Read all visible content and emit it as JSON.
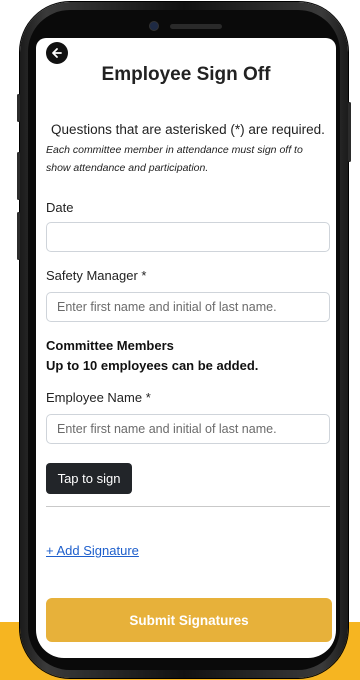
{
  "header": {
    "back_icon": "arrow-left-icon",
    "title": "Employee Sign Off"
  },
  "intro": {
    "required_note": "Questions that are asterisked (*) are required.",
    "instruction": "Each committee member in attendance must sign off to show attendance and participation."
  },
  "form": {
    "date": {
      "label": "Date",
      "value": "",
      "placeholder": ""
    },
    "safety_manager": {
      "label": "Safety Manager *",
      "value": "",
      "placeholder": "Enter first name and initial of last name."
    },
    "committee": {
      "heading": "Committee Members",
      "subheading": "Up to 10 employees can be added."
    },
    "employee_name": {
      "label": "Employee Name *",
      "value": "",
      "placeholder": "Enter first name and initial of last name."
    },
    "sign_button": "Tap to sign",
    "add_signature": "+ Add Signature",
    "submit_button": "Submit Signatures"
  },
  "colors": {
    "accent_background": "#f6b521",
    "submit_button": "#e7b13a",
    "sign_button": "#222529",
    "link": "#1e5fcc"
  }
}
